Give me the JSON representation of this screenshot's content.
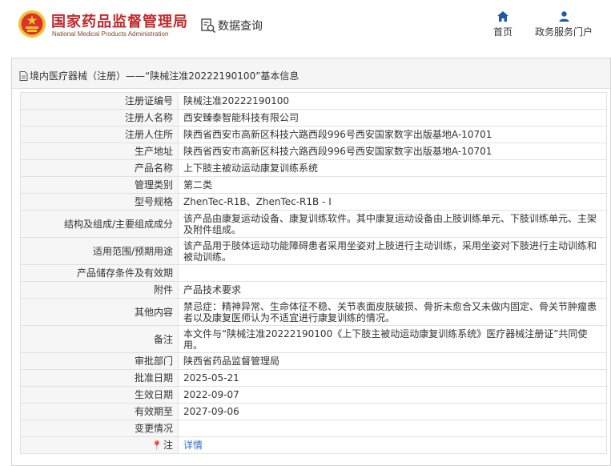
{
  "header": {
    "title_cn": "国家药品监督管理局",
    "title_en": "National Medical Products Administration",
    "query_label": "数据查询",
    "nav": [
      {
        "label": "首页",
        "icon": "home-icon"
      },
      {
        "label": "政务服务门户",
        "icon": "user-icon"
      }
    ],
    "colors": {
      "brand_red": "#c0292c",
      "emblem_gold": "#f2c230"
    }
  },
  "panel": {
    "breadcrumb": "境内医疗器械（注册）——“陕械注准20222190100”基本信息"
  },
  "rows": [
    {
      "label": "注册证编号",
      "value": "陕械注准20222190100"
    },
    {
      "label": "注册人名称",
      "value": "西安臻泰智能科技有限公司"
    },
    {
      "label": "注册人住所",
      "value": "陕西省西安市高新区科技六路西段996号西安国家数字出版基地A-10701"
    },
    {
      "label": "生产地址",
      "value": "陕西省西安市高新区科技六路西段996号西安国家数字出版基地A-10701"
    },
    {
      "label": "产品名称",
      "value": "上下肢主被动运动康复训练系统"
    },
    {
      "label": "管理类别",
      "value": "第二类"
    },
    {
      "label": "型号规格",
      "value": "ZhenTec-R1B、ZhenTec-R1B - I"
    },
    {
      "label": "结构及组成/主要组成成分",
      "value": "该产品由康复运动设备、康复训练软件。其中康复运动设备由上肢训练单元、下肢训练单元、主架及附件组成。"
    },
    {
      "label": "适用范围/预期用途",
      "value": "该产品用于肢体运动功能障碍患者采用坐姿对上肢进行主动训练，采用坐姿对下肢进行主动训练和被动训练。"
    },
    {
      "label": "产品储存条件及有效期",
      "value": ""
    },
    {
      "label": "附件",
      "value": "产品技术要求"
    },
    {
      "label": "其他内容",
      "value": "禁忌症：精神异常、生命体征不稳、关节表面皮肤破损、骨折未愈合又未做内固定、骨关节肿瘤患者以及康复医师认为不适宜进行康复训练的情况。"
    },
    {
      "label": "备注",
      "value": "本文件与“陕械注准20222190100《上下肢主被动运动康复训练系统》医疗器械注册证”共同使用。"
    },
    {
      "label": "审批部门",
      "value": "陕西省药品监督管理局"
    },
    {
      "label": "批准日期",
      "value": "2025-05-21"
    },
    {
      "label": "生效日期",
      "value": "2022-09-07"
    },
    {
      "label": "有效期至",
      "value": "2027-09-06"
    },
    {
      "label": "变更情况",
      "value": ""
    }
  ],
  "note_row": {
    "pin_icon": "📍",
    "label": "注",
    "link": "详情"
  }
}
